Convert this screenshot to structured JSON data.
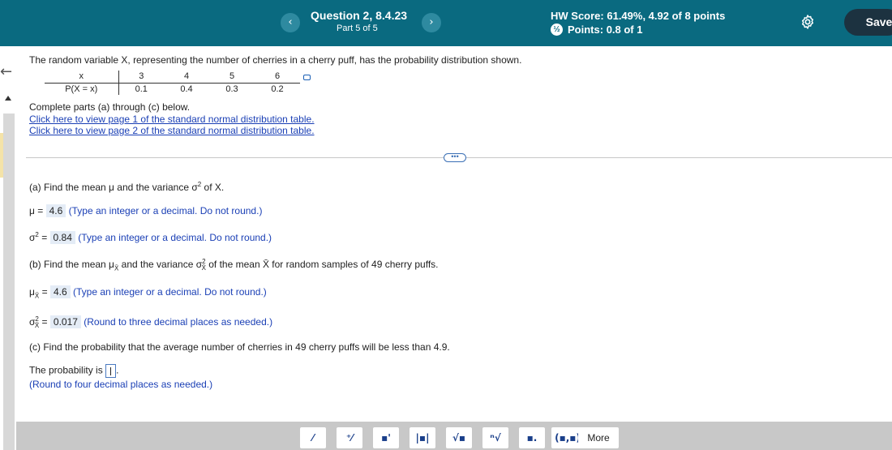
{
  "header": {
    "prev_glyph": "‹",
    "next_glyph": "›",
    "question_title": "Question 2, 8.4.23",
    "question_part": "Part 5 of 5",
    "hw_score_label": "HW Score:",
    "hw_score_value": "61.49%, 4.92 of 8 points",
    "points_label": "Points:",
    "points_value": "0.8 of 1",
    "points_icon_glyph": "½",
    "save_label": "Save",
    "icons": {
      "settings": "gear-icon",
      "points": "partial-credit-icon",
      "back": "back-arrow-icon"
    },
    "colors": {
      "bar": "#0a6a80",
      "save": "#1c3240"
    }
  },
  "problem": {
    "statement": "The random variable X, representing the number of cherries in a cherry puff, has the probability distribution shown.",
    "table": {
      "x_label": "x",
      "p_label": "P(X = x)",
      "x_values": [
        "3",
        "4",
        "5",
        "6"
      ],
      "p_values": [
        "0.1",
        "0.4",
        "0.3",
        "0.2"
      ]
    },
    "instruction": "Complete parts (a) through (c) below.",
    "link1": "Click here to view page 1 of the standard normal distribution table.",
    "link2": "Click here to view page 2 of the standard normal distribution table."
  },
  "divider": {
    "ellipsis": "•••"
  },
  "part_a": {
    "question_pre": "(a) Find the mean μ and the variance σ",
    "question_sup": "2",
    "question_post": " of X.",
    "mu_label": "μ =",
    "mu_value": "4.6",
    "mu_hint": "(Type an integer or a decimal. Do not round.)",
    "var_label_base": "σ",
    "var_label_sup": "2",
    "var_label_eq": " =",
    "var_value": "0.84",
    "var_hint": "(Type an integer or a decimal. Do not round.)"
  },
  "part_b": {
    "question_1": "(b) Find the mean μ",
    "question_sub_1": "X̄",
    "question_2": " and the variance σ",
    "question_sup_2": "2",
    "question_sub_2": "X̄",
    "question_3": " of the mean X̄ for random samples of 49 cherry puffs.",
    "mu_label_base": "μ",
    "mu_label_sub": "X̄",
    "mu_label_eq": " =",
    "mu_value": "4.6",
    "mu_hint": "(Type an integer or a decimal. Do not round.)",
    "var_label_base": "σ",
    "var_label_sup": "2",
    "var_label_sub": "X̄",
    "var_label_eq": " =",
    "var_value": "0.017",
    "var_hint": "(Round to three decimal places as needed.)"
  },
  "part_c": {
    "question": "(c) Find the probability that the average number of cherries in 49 cherry puffs will be less than 4.9.",
    "answer_prefix": "The probability is",
    "answer_suffix": ".",
    "hint": "(Round to four decimal places as needed.)"
  },
  "toolbar": {
    "tools": [
      "fraction",
      "mixed-number",
      "exponent",
      "absolute-value",
      "square-root",
      "nth-root",
      "subscript",
      "ordered-pair"
    ],
    "glyphs": [
      "⁄",
      "⁺⁄",
      "▪'",
      "|▪|",
      "√▪",
      "ⁿ√",
      "▪.",
      "(▪,▪)"
    ],
    "more_label": "More"
  }
}
